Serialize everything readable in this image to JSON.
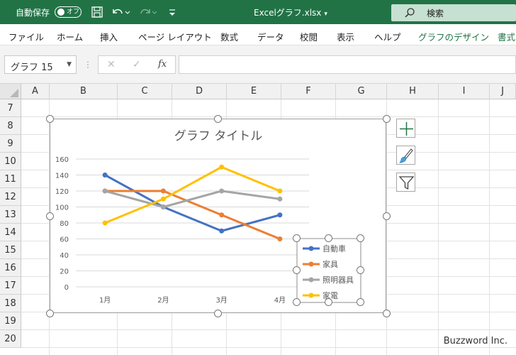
{
  "titlebar": {
    "autosave_label": "自動保存",
    "autosave_state": "オフ",
    "filename": "Excelグラフ.xlsx",
    "search_label": "検索"
  },
  "ribbon_tabs": [
    {
      "label": "ファイル"
    },
    {
      "label": "ホーム"
    },
    {
      "label": "挿入"
    },
    {
      "label": "ページ レイアウト"
    },
    {
      "label": "数式"
    },
    {
      "label": "データ"
    },
    {
      "label": "校閲"
    },
    {
      "label": "表示"
    },
    {
      "label": "ヘルプ"
    },
    {
      "label": "グラフのデザイン"
    },
    {
      "label": "書式"
    }
  ],
  "formula_bar": {
    "name_box": "グラフ 15",
    "fx": "fx",
    "value": ""
  },
  "columns": [
    "A",
    "B",
    "C",
    "D",
    "E",
    "F",
    "G",
    "H",
    "I",
    "J"
  ],
  "rows": [
    "7",
    "8",
    "9",
    "10",
    "11",
    "12",
    "13",
    "14",
    "15",
    "16",
    "17",
    "18",
    "19",
    "20"
  ],
  "chart_data": {
    "type": "line",
    "title": "グラフ タイトル",
    "categories": [
      "1月",
      "2月",
      "3月",
      "4月"
    ],
    "ylim": [
      0,
      160
    ],
    "yticks": [
      "0",
      "20",
      "40",
      "60",
      "80",
      "100",
      "120",
      "140",
      "160"
    ],
    "grid": true,
    "legend_position": "right",
    "series": [
      {
        "name": "自動車",
        "values": [
          140,
          100,
          70,
          90
        ],
        "color": "#4472c4"
      },
      {
        "name": "家具",
        "values": [
          120,
          120,
          90,
          60
        ],
        "color": "#ed7d31"
      },
      {
        "name": "照明器具",
        "values": [
          120,
          100,
          120,
          110
        ],
        "color": "#a5a5a5"
      },
      {
        "name": "家電",
        "values": [
          80,
          110,
          150,
          120
        ],
        "color": "#ffc000"
      }
    ]
  },
  "watermark": "Buzzword Inc."
}
